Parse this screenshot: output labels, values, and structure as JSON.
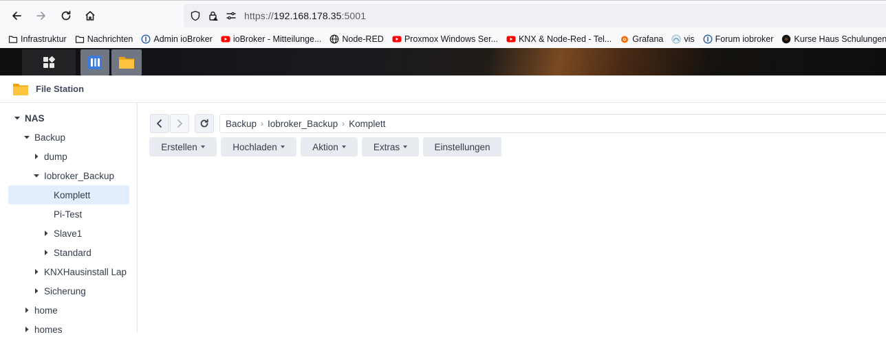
{
  "browser": {
    "url_scheme": "https://",
    "url_host": "192.168.178.35",
    "url_port": ":5001",
    "bookmarks": [
      {
        "label": "Infrastruktur",
        "icon": "folder-icon"
      },
      {
        "label": "Nachrichten",
        "icon": "folder-icon"
      },
      {
        "label": "Admin ioBroker",
        "icon": "iobroker-icon"
      },
      {
        "label": "ioBroker - Mitteilunge...",
        "icon": "youtube-icon"
      },
      {
        "label": "Node-RED",
        "icon": "globe-icon"
      },
      {
        "label": "Proxmox Windows Ser...",
        "icon": "youtube-icon"
      },
      {
        "label": "KNX & Node-Red - Tel...",
        "icon": "youtube-icon"
      },
      {
        "label": "Grafana",
        "icon": "grafana-icon"
      },
      {
        "label": "vis",
        "icon": "vis-icon"
      },
      {
        "label": "Forum iobroker",
        "icon": "iobroker-icon"
      },
      {
        "label": "Kurse Haus Schulungen",
        "icon": "dark-circle-icon"
      }
    ]
  },
  "window": {
    "title": "File Station"
  },
  "tree": [
    {
      "label": "NAS",
      "arrow": "down"
    },
    {
      "label": "Backup",
      "arrow": "down"
    },
    {
      "label": "dump",
      "arrow": "right"
    },
    {
      "label": "Iobroker_Backup",
      "arrow": "down"
    },
    {
      "label": "Komplett",
      "arrow": "none",
      "selected": true
    },
    {
      "label": "Pi-Test",
      "arrow": "none"
    },
    {
      "label": "Slave1",
      "arrow": "right"
    },
    {
      "label": "Standard",
      "arrow": "right"
    },
    {
      "label": "KNXHausinstall Lap",
      "arrow": "right"
    },
    {
      "label": "Sicherung",
      "arrow": "right"
    },
    {
      "label": "home",
      "arrow": "right"
    },
    {
      "label": "homes",
      "arrow": "right"
    }
  ],
  "breadcrumb": [
    "Backup",
    "Iobroker_Backup",
    "Komplett"
  ],
  "toolbar": {
    "create": "Erstellen",
    "upload": "Hochladen",
    "action": "Aktion",
    "extras": "Extras",
    "settings": "Einstellungen"
  }
}
